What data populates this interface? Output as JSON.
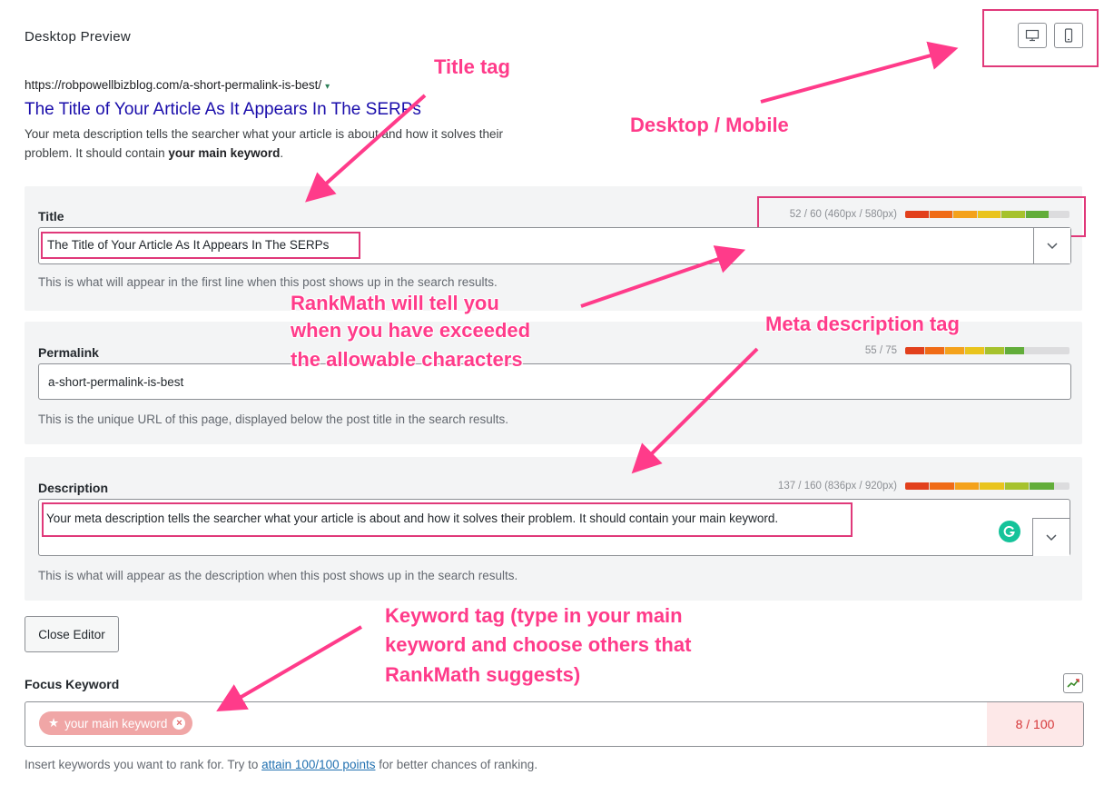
{
  "preview": {
    "heading": "Desktop Preview",
    "url": "https://robpowellbizblog.com/a-short-permalink-is-best/",
    "url_caret": "▾",
    "title": "The Title of Your Article As It Appears In The SERPs",
    "desc_prefix": "Your meta description tells the searcher what your article is about and how it solves their problem. It should contain ",
    "desc_bold": "your main keyword",
    "desc_suffix": "."
  },
  "devices": {
    "desktop_icon": "desktop-icon",
    "mobile_icon": "mobile-icon"
  },
  "title_field": {
    "label": "Title",
    "counter": "52 / 60 (460px / 580px)",
    "value": "The Title of Your Article As It Appears In The SERPs",
    "help": "This is what will appear in the first line when this post shows up in the search results.",
    "fill": 0.88
  },
  "permalink_field": {
    "label": "Permalink",
    "counter": "55 / 75",
    "value": "a-short-permalink-is-best",
    "help": "This is the unique URL of this page, displayed below the post title in the search results.",
    "fill": 0.73
  },
  "description_field": {
    "label": "Description",
    "counter": "137 / 160 (836px / 920px)",
    "value": "Your meta description tells the searcher what your article is about and how it solves their problem. It should contain your main keyword.",
    "help": "This is what will appear as the description when this post shows up in the search results.",
    "fill": 0.91
  },
  "close_editor": "Close Editor",
  "focus_keyword": {
    "label": "Focus Keyword",
    "chip": "your main keyword",
    "chip_star": "★",
    "chip_remove": "×",
    "score": "8 / 100",
    "help_prefix": "Insert keywords you want to rank for. Try to ",
    "help_link": "attain 100/100 points",
    "help_suffix": " for better chances of ranking."
  },
  "annotations": {
    "title_tag": "Title tag",
    "desktop_mobile": "Desktop / Mobile",
    "rankmath_line1": "RankMath will tell you",
    "rankmath_line2": "when you have exceeded",
    "rankmath_line3": "the allowable characters",
    "meta_desc_tag": "Meta description tag",
    "keyword_line1": "Keyword tag (type in your main",
    "keyword_line2": "keyword and choose others that",
    "keyword_line3": "RankMath suggests)"
  },
  "colors": {
    "accent_pink": "#ff3b8a",
    "serp_title": "#1a0dab",
    "bar_segments": [
      "#e2401c",
      "#f06b16",
      "#f4a21c",
      "#e9c41d",
      "#a6c22d",
      "#62ad3a"
    ]
  }
}
